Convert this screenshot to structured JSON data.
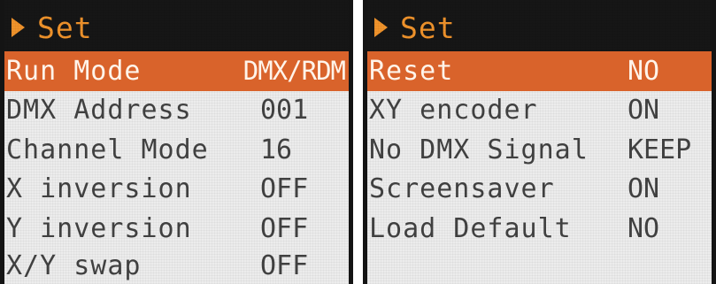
{
  "left_screen": {
    "header": {
      "title": "Set"
    },
    "rows": [
      {
        "label": "Run Mode",
        "value": "DMX/RDM"
      },
      {
        "label": "DMX Address",
        "value": "001"
      },
      {
        "label": "Channel Mode",
        "value": "16"
      },
      {
        "label": "X inversion",
        "value": "OFF"
      },
      {
        "label": "Y inversion",
        "value": "OFF"
      },
      {
        "label": "X/Y swap",
        "value": "OFF"
      }
    ]
  },
  "right_screen": {
    "header": {
      "title": "Set"
    },
    "rows": [
      {
        "label": "Reset",
        "value": "NO"
      },
      {
        "label": "XY encoder",
        "value": "ON"
      },
      {
        "label": "No DMX Signal",
        "value": "KEEP"
      },
      {
        "label": "Screensaver",
        "value": "ON"
      },
      {
        "label": "Load Default",
        "value": "NO"
      }
    ]
  },
  "colors": {
    "accent": "#f0932b",
    "selected_row": "#d9632b",
    "header_bg": "#161616",
    "screen_bg": "#ececec",
    "text": "#404040"
  }
}
